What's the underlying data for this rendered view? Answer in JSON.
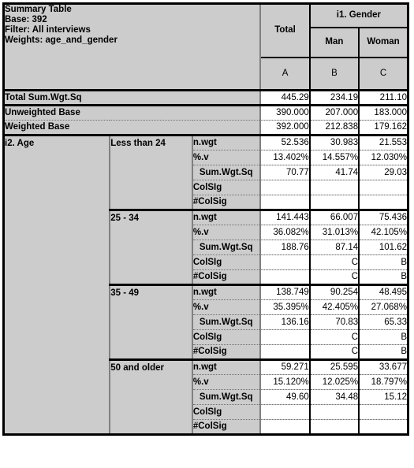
{
  "header": {
    "title_lines": [
      "Summary Table",
      "Base: 392",
      "Filter: All interviews",
      "Weights: age_and_gender"
    ],
    "total_label": "Total",
    "group_label": "i1. Gender",
    "sub_labels": [
      "Man",
      "Woman"
    ],
    "column_letters": [
      "A",
      "B",
      "C"
    ]
  },
  "summary_rows": [
    {
      "label": "Total Sum.Wgt.Sq",
      "values": [
        "445.29",
        "234.19",
        "211.10"
      ]
    },
    {
      "label": "Unweighted Base",
      "values": [
        "390.000",
        "207.000",
        "183.000"
      ]
    },
    {
      "label": "Weighted Base",
      "values": [
        "392.000",
        "212.838",
        "179.162"
      ]
    }
  ],
  "body": {
    "variable_label": "i2. Age",
    "stat_labels": [
      "n.wgt",
      "%.v",
      "Sum.Wgt.Sq",
      "ColSIg",
      "#ColSig"
    ],
    "groups": [
      {
        "label": "Less than 24",
        "rows": [
          {
            "stat": "n.wgt",
            "values": [
              "52.536",
              "30.983",
              "21.553"
            ]
          },
          {
            "stat": "%.v",
            "values": [
              "13.402%",
              "14.557%",
              "12.030%"
            ]
          },
          {
            "stat": "Sum.Wgt.Sq",
            "values": [
              "70.77",
              "41.74",
              "29.03"
            ]
          },
          {
            "stat": "ColSIg",
            "values": [
              "",
              "",
              ""
            ]
          },
          {
            "stat": "#ColSig",
            "values": [
              "",
              "",
              ""
            ]
          }
        ]
      },
      {
        "label": "25 - 34",
        "rows": [
          {
            "stat": "n.wgt",
            "values": [
              "141.443",
              "66.007",
              "75.436"
            ]
          },
          {
            "stat": "%.v",
            "values": [
              "36.082%",
              "31.013%",
              "42.105%"
            ]
          },
          {
            "stat": "Sum.Wgt.Sq",
            "values": [
              "188.76",
              "87.14",
              "101.62"
            ]
          },
          {
            "stat": "ColSIg",
            "values": [
              "",
              "C",
              "B"
            ]
          },
          {
            "stat": "#ColSig",
            "values": [
              "",
              "C",
              "B"
            ]
          }
        ]
      },
      {
        "label": "35 - 49",
        "rows": [
          {
            "stat": "n.wgt",
            "values": [
              "138.749",
              "90.254",
              "48.495"
            ]
          },
          {
            "stat": "%.v",
            "values": [
              "35.395%",
              "42.405%",
              "27.068%"
            ]
          },
          {
            "stat": "Sum.Wgt.Sq",
            "values": [
              "136.16",
              "70.83",
              "65.33"
            ]
          },
          {
            "stat": "ColSIg",
            "values": [
              "",
              "C",
              "B"
            ]
          },
          {
            "stat": "#ColSig",
            "values": [
              "",
              "C",
              "B"
            ]
          }
        ]
      },
      {
        "label": "50 and older",
        "rows": [
          {
            "stat": "n.wgt",
            "values": [
              "59.271",
              "25.595",
              "33.677"
            ]
          },
          {
            "stat": "%.v",
            "values": [
              "15.120%",
              "12.025%",
              "18.797%"
            ]
          },
          {
            "stat": "Sum.Wgt.Sq",
            "values": [
              "49.60",
              "34.48",
              "15.12"
            ]
          },
          {
            "stat": "ColSIg",
            "values": [
              "",
              "",
              ""
            ]
          },
          {
            "stat": "#ColSig",
            "values": [
              "",
              "",
              ""
            ]
          }
        ]
      }
    ]
  },
  "colors": {
    "label_background": "#cccccc",
    "value_background": "#ffffff",
    "border": "#000000",
    "separator": "#808080"
  }
}
